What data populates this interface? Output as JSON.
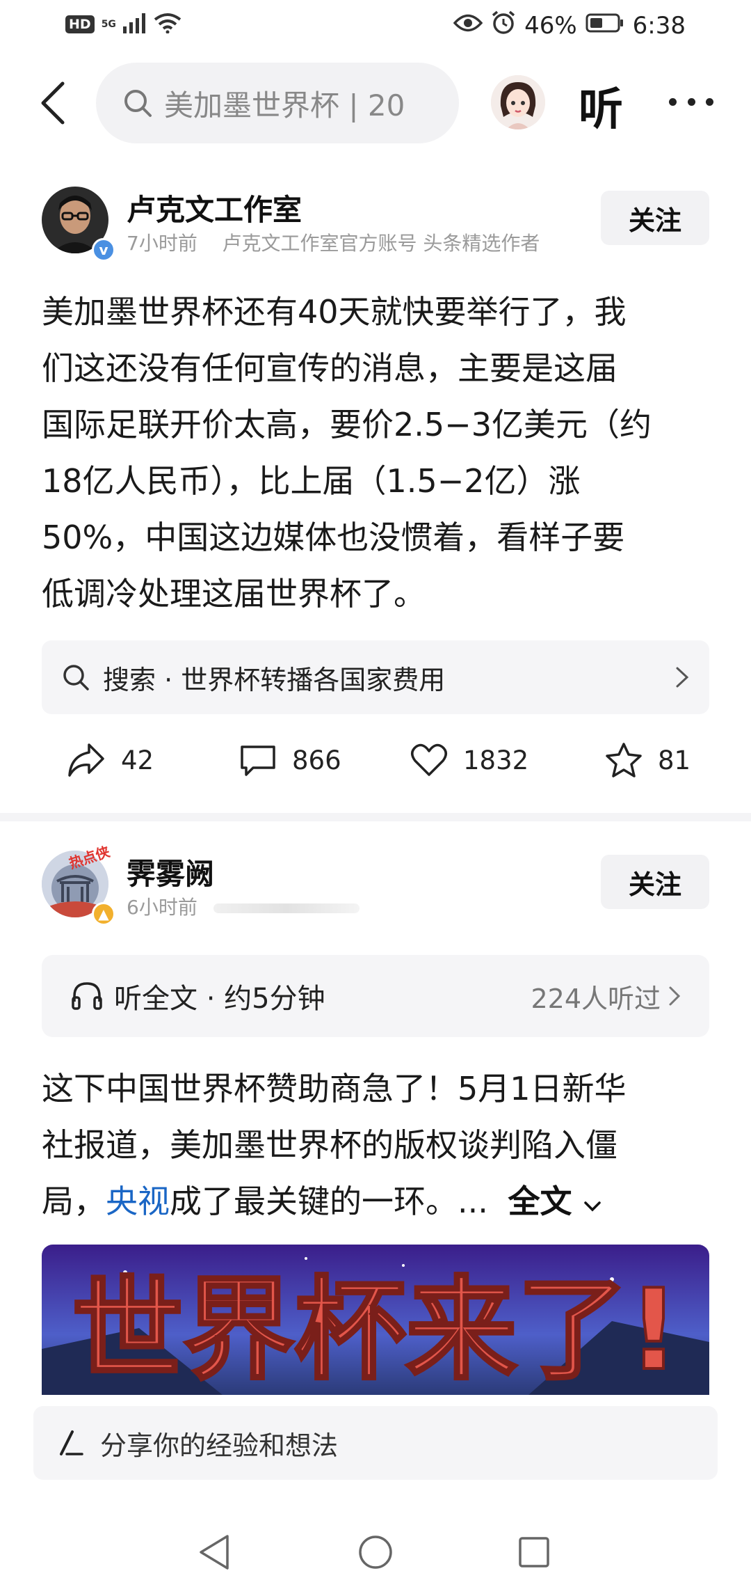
{
  "status_bar": {
    "hd": "HD",
    "network": "5G",
    "battery": "46%",
    "time": "6:38"
  },
  "top_nav": {
    "search_text": "美加墨世界杯 | 20",
    "listen_label": "听"
  },
  "post1": {
    "author": "卢克文工作室",
    "time": "7小时前",
    "meta": "卢克文工作室官方账号 头条精选作者",
    "follow_label": "关注",
    "lines": [
      "美加墨世界杯还有40天就快要举行了，我",
      "们这还没有任何宣传的消息，主要是这届",
      "国际足联开价太高，要价2.5−3亿美元（约",
      "18亿人民币），比上届（1.5−2亿）涨",
      "50%，中国这边媒体也没惯着，看样子要",
      "低调冷处理这届世界杯了。"
    ],
    "search_suggest": "搜索 · 世界杯转播各国家费用",
    "actions": {
      "share": "42",
      "comment": "866",
      "like": "1832",
      "favorite": "81"
    }
  },
  "post2": {
    "author": "霁雾阙",
    "time": "6小时前",
    "avatar_badge": "热点侠",
    "follow_label": "关注",
    "listen": {
      "label": "听全文 · 约5分钟",
      "count": "224人听过"
    },
    "lines": [
      "这下中国世界杯赞助商急了！5月1日新华",
      "社报道，美加墨世界杯的版权谈判陷入僵"
    ],
    "line3_before": "局，",
    "line3_link": "央视",
    "line3_after": "成了最关键的一环。...",
    "full_text_label": "全文",
    "banner_text": "世界杯来了!"
  },
  "comment_bar": {
    "placeholder": "分享你的经验和想法"
  }
}
